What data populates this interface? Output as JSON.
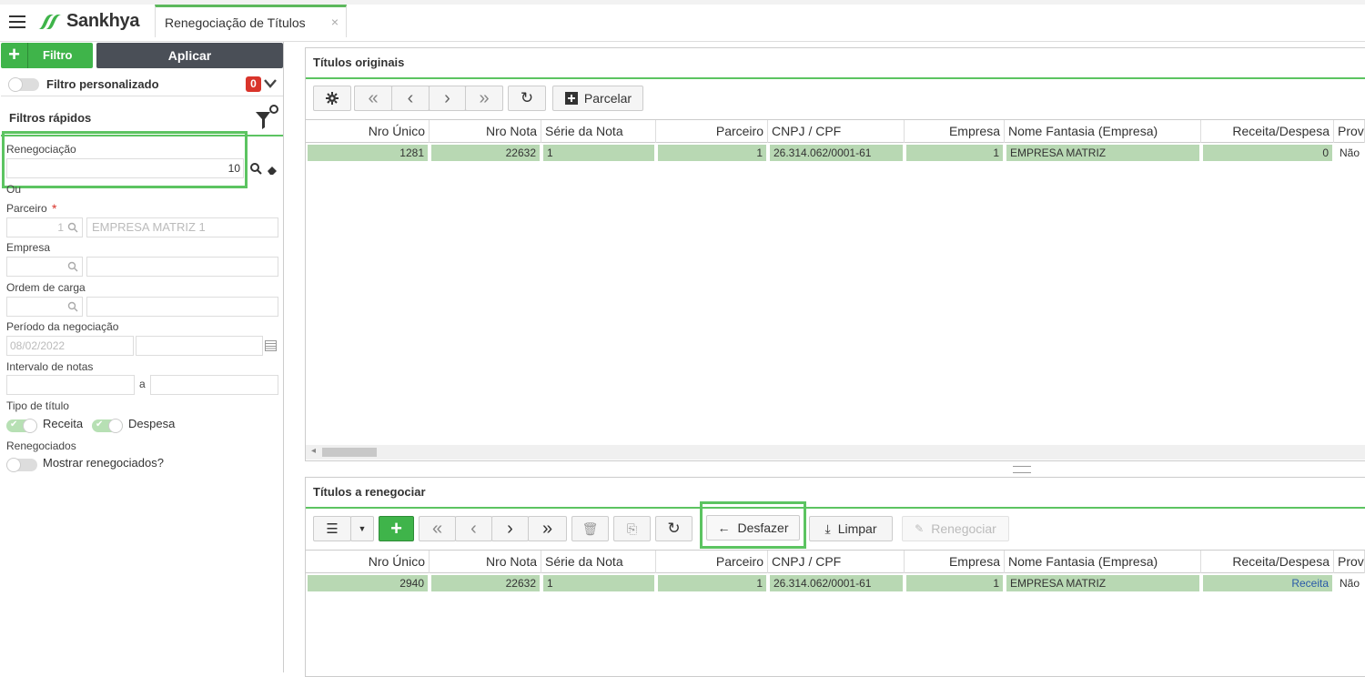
{
  "app": {
    "brand": "Sankhya",
    "tab_title": "Renegociação de Títulos",
    "tab_close": "×"
  },
  "left": {
    "filtro_label": "Filtro",
    "aplicar_label": "Aplicar",
    "filtro_personalizado": "Filtro personalizado",
    "badge_count": "0",
    "filtros_rapidos": "Filtros rápidos",
    "renegociacao_label": "Renegociação",
    "renegociacao_value": "10",
    "ou": "Ou",
    "parceiro_label": "Parceiro",
    "parceiro_req": "*",
    "parceiro_code": "1",
    "parceiro_name": "EMPRESA MATRIZ 1",
    "empresa_label": "Empresa",
    "ordem_label": "Ordem de carga",
    "periodo_label": "Período da negociação",
    "periodo_from": "08/02/2022",
    "intervalo_label": "Intervalo de notas",
    "intervalo_a": "a",
    "tipo_label": "Tipo de título",
    "receita": "Receita",
    "despesa": "Despesa",
    "renegociados_label": "Renegociados",
    "mostrar": "Mostrar renegociados?"
  },
  "originais": {
    "title": "Títulos originais",
    "parcelar": "Parcelar",
    "headers": [
      "Nro Único",
      "Nro Nota",
      "Série da Nota",
      "Parceiro",
      "CNPJ / CPF",
      "Empresa",
      "Nome Fantasia (Empresa)",
      "Receita/Despesa",
      "Provi"
    ],
    "row": [
      "1281",
      "22632",
      "1",
      "1",
      "26.314.062/0001-61",
      "1",
      "EMPRESA MATRIZ",
      "0",
      "Não"
    ]
  },
  "renegociar": {
    "title": "Títulos a renegociar",
    "desfazer": "Desfazer",
    "limpar": "Limpar",
    "renegociar_btn": "Renegociar",
    "headers": [
      "Nro Único",
      "Nro Nota",
      "Série da Nota",
      "Parceiro",
      "CNPJ / CPF",
      "Empresa",
      "Nome Fantasia (Empresa)",
      "Receita/Despesa",
      "Provi"
    ],
    "row": [
      "2940",
      "22632",
      "1",
      "1",
      "26.314.062/0001-61",
      "1",
      "EMPRESA MATRIZ",
      "Receita",
      "Não"
    ]
  },
  "colors": {
    "green": "#3fb44a",
    "highlight": "#5cc461",
    "row": "#b8d8b3",
    "badge": "#d9342b"
  }
}
